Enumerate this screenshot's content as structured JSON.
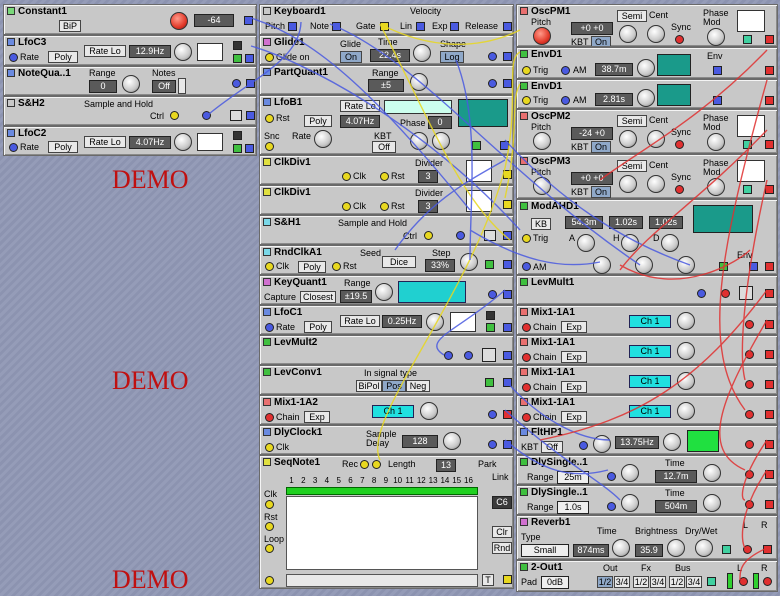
{
  "demo_text": "DEMO",
  "left": {
    "constant1": {
      "title": "Constant1",
      "bip": "BiP",
      "value": "-64"
    },
    "lfoc3": {
      "title": "LfoC3",
      "rate_label": "Rate",
      "poly": "Poly",
      "rate_lo": "Rate Lo",
      "rate": "12.9Hz"
    },
    "notequa": {
      "title": "NoteQua..1",
      "range_label": "Range",
      "range": "0",
      "notes_label": "Notes",
      "notes": "Off"
    },
    "sh2": {
      "title": "S&H2",
      "desc": "Sample and Hold",
      "ctrl": "Ctrl"
    },
    "lfoc2": {
      "title": "LfoC2",
      "rate_label": "Rate",
      "poly": "Poly",
      "rate_lo": "Rate Lo",
      "rate": "4.07Hz"
    }
  },
  "mid": {
    "keyboard1": {
      "title": "Keyboard1",
      "velocity": "Velocity",
      "pitch": "Pitch",
      "note": "Note",
      "gate": "Gate",
      "lin": "Lin",
      "exp": "Exp",
      "release": "Release"
    },
    "glide1": {
      "title": "Glide1",
      "glide_label": "Glide",
      "glide": "On",
      "time_label": "Time",
      "time": "22.4s",
      "shape_label": "Shape",
      "shape": "Log",
      "glide_on": "Glide on"
    },
    "partquant1": {
      "title": "PartQuant1",
      "range_label": "Range",
      "range": "±5"
    },
    "lfob1": {
      "title": "LfoB1",
      "rate_lo": "Rate Lo",
      "rst": "Rst",
      "poly": "Poly",
      "rate": "4.07Hz",
      "phase_label": "Phase",
      "phase": "0",
      "snc": "Snc",
      "rate_label": "Rate",
      "kbt_label": "KBT",
      "kbt": "Off"
    },
    "clkdiv1a": {
      "title": "ClkDiv1",
      "divider_label": "Divider",
      "divider": "3",
      "clk": "Clk",
      "rst": "Rst"
    },
    "clkdiv1b": {
      "title": "ClkDiv1",
      "divider_label": "Divider",
      "divider": "3",
      "clk": "Clk",
      "rst": "Rst"
    },
    "sh1": {
      "title": "S&H1",
      "desc": "Sample and Hold",
      "ctrl": "Ctrl"
    },
    "rndclka1": {
      "title": "RndClkA1",
      "seed_label": "Seed",
      "step_label": "Step",
      "clk": "Clk",
      "poly": "Poly",
      "rst": "Rst",
      "dice": "Dice",
      "step": "33%"
    },
    "keyquant1": {
      "title": "KeyQuant1",
      "range_label": "Range",
      "capture": "Capture",
      "closest": "Closest",
      "range": "±19.5"
    },
    "lfoc1": {
      "title": "LfoC1",
      "rate_label": "Rate",
      "poly": "Poly",
      "rate_lo": "Rate Lo",
      "rate": "0.25Hz"
    },
    "levmult2": {
      "title": "LevMult2"
    },
    "levconv1": {
      "title": "LevConv1",
      "in_label": "In signal type",
      "bipol": "BiPol",
      "pos": "Pos",
      "neg": "Neg"
    },
    "mix1a2": {
      "title": "Mix1-1A2",
      "chain": "Chain",
      "exp": "Exp",
      "ch": "Ch 1"
    },
    "dlyclock1": {
      "title": "DlyClock1",
      "clk": "Clk",
      "sample_delay": "Sample\nDelay",
      "value": "128"
    },
    "seqnote1": {
      "title": "SeqNote1",
      "rec": "Rec",
      "length_label": "Length",
      "length": "13",
      "park": "Park",
      "link": "Link",
      "clk": "Clk",
      "rst": "Rst",
      "loop": "Loop",
      "note": "C6",
      "clr": "Clr",
      "rnd": "Rnd",
      "t": "T",
      "steps": [
        "1",
        "2",
        "3",
        "4",
        "5",
        "6",
        "7",
        "8",
        "9",
        "10",
        "11",
        "12",
        "13",
        "14",
        "15",
        "16"
      ]
    }
  },
  "right": {
    "oscpm1": {
      "title": "OscPM1",
      "pitch": "Pitch",
      "semi": "Semi",
      "cent": "Cent",
      "tune": "+0  +0",
      "kbt": "KBT",
      "on": "On",
      "sync": "Sync",
      "phase_mod": "Phase\nMod"
    },
    "envd1a": {
      "title": "EnvD1",
      "trig": "Trig",
      "am": "AM",
      "time": "38.7m",
      "env": "Env"
    },
    "envd1b": {
      "title": "EnvD1",
      "trig": "Trig",
      "am": "AM",
      "time": "2.81s"
    },
    "oscpm2": {
      "title": "OscPM2",
      "pitch": "Pitch",
      "semi": "Semi",
      "cent": "Cent",
      "tune": "-24  +0",
      "kbt": "KBT",
      "on": "On",
      "sync": "Sync",
      "phase_mod": "Phase\nMod"
    },
    "oscpm3": {
      "title": "OscPM3",
      "pitch": "Pitch",
      "semi": "Semi",
      "cent": "Cent",
      "tune": "+0  +0",
      "kbt": "KBT",
      "on": "On",
      "sync": "Sync",
      "phase_mod": "Phase\nMod"
    },
    "modahd1": {
      "title": "ModAHD1",
      "kb": "KB",
      "a_time": "54.3m",
      "h_time": "1.02s",
      "d_time": "1.02s",
      "trig": "Trig",
      "a": "A",
      "h": "H",
      "d": "D",
      "am": "AM",
      "env": "Env"
    },
    "levmult1": {
      "title": "LevMult1"
    },
    "mix1a1a": {
      "title": "Mix1-1A1",
      "chain": "Chain",
      "exp": "Exp",
      "ch": "Ch 1"
    },
    "mix1a1b": {
      "title": "Mix1-1A1",
      "chain": "Chain",
      "exp": "Exp",
      "ch": "Ch 1"
    },
    "mix1a1c": {
      "title": "Mix1-1A1",
      "chain": "Chain",
      "exp": "Exp",
      "ch": "Ch 1"
    },
    "mix1a1d": {
      "title": "Mix1-1A1",
      "chain": "Chain",
      "exp": "Exp",
      "ch": "Ch 1"
    },
    "flthp1": {
      "title": "FltHP1",
      "kbt": "KBT",
      "off": "Off",
      "freq": "13.75Hz"
    },
    "dlysingle1": {
      "title": "DlySingle..1",
      "range_label": "Range",
      "range": "25m",
      "time_label": "Time",
      "time": "12.7m"
    },
    "dlysingle2": {
      "title": "DlySingle..1",
      "range_label": "Range",
      "range": "1.0s",
      "time_label": "Time",
      "time": "504m"
    },
    "reverb1": {
      "title": "Reverb1",
      "type_label": "Type",
      "type": "Small",
      "time_label": "Time",
      "time": "874ms",
      "bright_label": "Brightness",
      "bright": "35.9",
      "drywet_label": "Dry/Wet",
      "l": "L",
      "r": "R"
    },
    "out2": {
      "title": "2-Out1",
      "out_label": "Out",
      "fx_label": "Fx",
      "bus_label": "Bus",
      "pad": "Pad",
      "pad_val": "0dB",
      "o12": "1/2",
      "o34": "3/4",
      "l": "L",
      "r": "R"
    }
  }
}
